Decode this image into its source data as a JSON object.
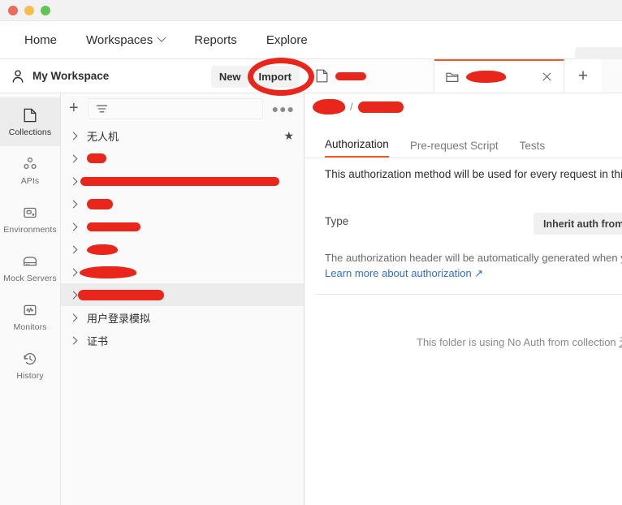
{
  "window": {
    "traffic_lights": [
      "close",
      "minimize",
      "zoom"
    ],
    "colors": {
      "close": "#ed6a5e",
      "minimize": "#f4bd4f",
      "zoom": "#61c454"
    }
  },
  "topnav": {
    "items": [
      {
        "label": "Home",
        "icon": null
      },
      {
        "label": "Workspaces",
        "icon": "chevron-down-icon"
      },
      {
        "label": "Reports",
        "icon": null
      },
      {
        "label": "Explore",
        "icon": null
      }
    ],
    "search_placeholder": ""
  },
  "workspace_bar": {
    "icon": "user-icon",
    "name": "My Workspace",
    "buttons": [
      {
        "label": "New",
        "name": "new-button"
      },
      {
        "label": "Import",
        "name": "import-button"
      }
    ]
  },
  "annotation": {
    "type": "red-ellipse-highlight",
    "target": "Import",
    "color": "#e8261c"
  },
  "rail": {
    "items": [
      {
        "label": "Collections",
        "icon": "collections-icon",
        "active": true
      },
      {
        "label": "APIs",
        "icon": "apis-icon",
        "active": false
      },
      {
        "label": "Environments",
        "icon": "environments-icon",
        "active": false
      },
      {
        "label": "Mock Servers",
        "icon": "mock-servers-icon",
        "active": false
      },
      {
        "label": "Monitors",
        "icon": "monitors-icon",
        "active": false
      },
      {
        "label": "History",
        "icon": "history-icon",
        "active": false
      }
    ]
  },
  "sidebar": {
    "toolbar": {
      "add_icon": "plus-icon",
      "filter_icon": "filter-icon",
      "filter_value": "",
      "more_icon": "more-horizontal-icon"
    },
    "tree": [
      {
        "label": "无人机",
        "redacted": false,
        "starred": true,
        "selected": false,
        "scribble_width": 0
      },
      {
        "label": "",
        "redacted": true,
        "starred": false,
        "selected": false,
        "scribble_width": 24
      },
      {
        "label": "",
        "redacted": true,
        "starred": false,
        "selected": false,
        "scribble_width": 240
      },
      {
        "label": "",
        "redacted": true,
        "starred": false,
        "selected": false,
        "scribble_width": 32
      },
      {
        "label": "",
        "redacted": true,
        "starred": false,
        "selected": false,
        "scribble_width": 66
      },
      {
        "label": "",
        "redacted": true,
        "starred": false,
        "selected": false,
        "scribble_width": 38
      },
      {
        "label": "",
        "redacted": true,
        "starred": false,
        "selected": false,
        "scribble_width": 68
      },
      {
        "label": "",
        "redacted": true,
        "starred": false,
        "selected": true,
        "scribble_width": 104
      },
      {
        "label": "用户登录模拟",
        "redacted": false,
        "starred": false,
        "selected": false,
        "scribble_width": 0
      },
      {
        "label": "证书",
        "redacted": false,
        "starred": false,
        "selected": false,
        "scribble_width": 0
      }
    ]
  },
  "tabs": {
    "items": [
      {
        "icon": "file-icon",
        "label": "",
        "redacted": true,
        "active": false,
        "scribble_width": 38
      },
      {
        "icon": "folder-icon",
        "label": "",
        "redacted": true,
        "active": true,
        "scribble_width": 48
      }
    ],
    "close_icon": "close-icon",
    "new_tab_icon": "plus-icon"
  },
  "breadcrumb": {
    "separator": "/",
    "segments": [
      {
        "label": "",
        "redacted": true,
        "scribble_width": 38
      },
      {
        "label": "",
        "redacted": true,
        "scribble_width": 54
      }
    ]
  },
  "panel": {
    "inner_tabs": [
      {
        "label": "Authorization",
        "active": true
      },
      {
        "label": "Pre-request Script",
        "active": false
      },
      {
        "label": "Tests",
        "active": false
      }
    ],
    "description": "This authorization method will be used for every request in this fol",
    "type_label": "Type",
    "type_value": "Inherit auth from p",
    "autogen_note": "The authorization header will be automatically generated when y",
    "learn_link": "Learn more about authorization ↗",
    "inherited_note_prefix": "This folder is using No Auth from collection ",
    "inherited_note_link": "无"
  },
  "accent_color": "#ef5b25"
}
